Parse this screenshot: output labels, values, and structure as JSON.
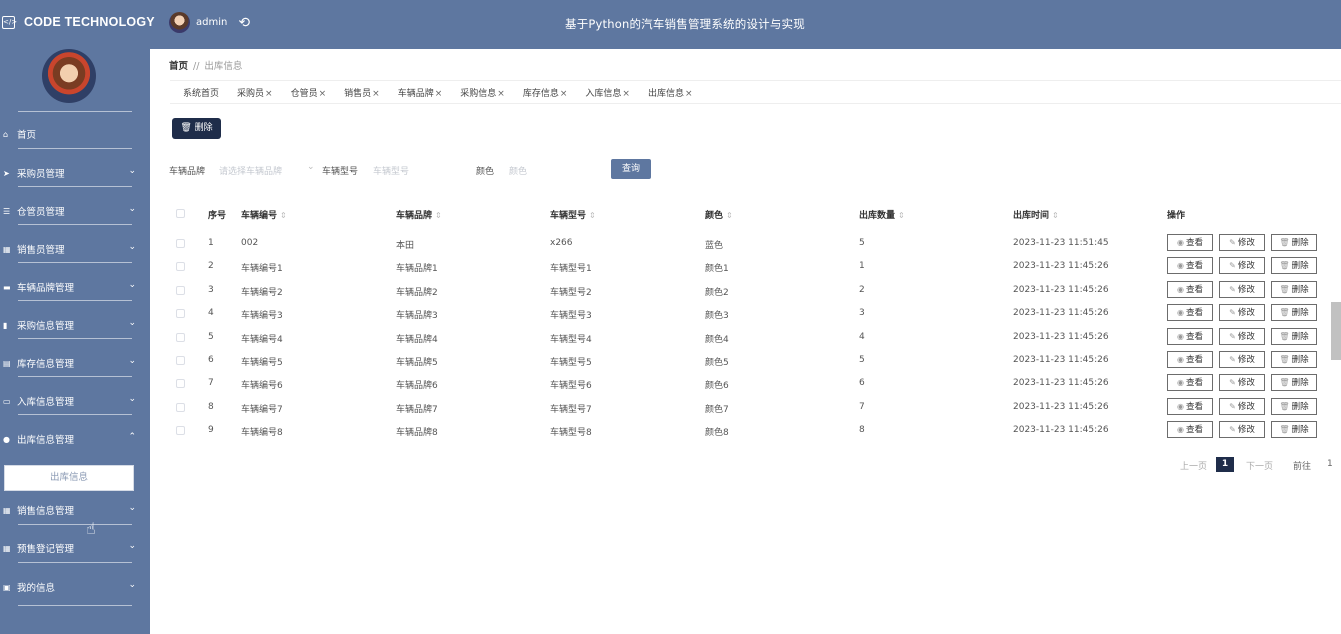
{
  "header": {
    "logo_text": "CODE TECHNOLOGY",
    "logo_icon": "code-icon",
    "user_name": "admin",
    "system_title": "基于Python的汽车销售管理系统的设计与实现"
  },
  "sidebar": {
    "items": [
      {
        "label": "首页",
        "icon": "home-icon"
      },
      {
        "label": "采购员管理",
        "icon": "send-icon"
      },
      {
        "label": "仓管员管理",
        "icon": "list-icon"
      },
      {
        "label": "销售员管理",
        "icon": "grid-icon"
      },
      {
        "label": "车辆品牌管理",
        "icon": "chat-icon"
      },
      {
        "label": "采购信息管理",
        "icon": "bar-chart-icon"
      },
      {
        "label": "库存信息管理",
        "icon": "ticket-icon"
      },
      {
        "label": "入库信息管理",
        "icon": "monitor-icon"
      },
      {
        "label": "出库信息管理",
        "icon": "user-icon"
      },
      {
        "label": "销售信息管理",
        "icon": "grid-icon"
      },
      {
        "label": "预售登记管理",
        "icon": "grid-icon"
      },
      {
        "label": "我的信息",
        "icon": "window-icon"
      }
    ],
    "sub_item": "出库信息"
  },
  "breadcrumb": {
    "home": "首页",
    "separator": "//",
    "current": "出库信息"
  },
  "tabs": [
    {
      "label": "系统首页",
      "closable": false
    },
    {
      "label": "采购员",
      "closable": true
    },
    {
      "label": "仓管员",
      "closable": true
    },
    {
      "label": "销售员",
      "closable": true
    },
    {
      "label": "车辆品牌",
      "closable": true
    },
    {
      "label": "采购信息",
      "closable": true
    },
    {
      "label": "库存信息",
      "closable": true
    },
    {
      "label": "入库信息",
      "closable": true
    },
    {
      "label": "出库信息",
      "closable": true
    }
  ],
  "toolbar": {
    "delete_label": "删除"
  },
  "filters": {
    "brand_label": "车辆品牌",
    "brand_placeholder": "请选择车辆品牌",
    "model_label": "车辆型号",
    "model_placeholder": "车辆型号",
    "color_label": "颜色",
    "color_placeholder": "颜色",
    "search_label": "查询"
  },
  "table": {
    "headers": [
      "序号",
      "车辆编号",
      "车辆品牌",
      "车辆型号",
      "颜色",
      "出库数量",
      "出库时间",
      "操作"
    ],
    "rows": [
      [
        "1",
        "002",
        "本田",
        "x266",
        "蓝色",
        "5",
        "2023-11-23 11:51:45"
      ],
      [
        "2",
        "车辆编号1",
        "车辆品牌1",
        "车辆型号1",
        "颜色1",
        "1",
        "2023-11-23 11:45:26"
      ],
      [
        "3",
        "车辆编号2",
        "车辆品牌2",
        "车辆型号2",
        "颜色2",
        "2",
        "2023-11-23 11:45:26"
      ],
      [
        "4",
        "车辆编号3",
        "车辆品牌3",
        "车辆型号3",
        "颜色3",
        "3",
        "2023-11-23 11:45:26"
      ],
      [
        "5",
        "车辆编号4",
        "车辆品牌4",
        "车辆型号4",
        "颜色4",
        "4",
        "2023-11-23 11:45:26"
      ],
      [
        "6",
        "车辆编号5",
        "车辆品牌5",
        "车辆型号5",
        "颜色5",
        "5",
        "2023-11-23 11:45:26"
      ],
      [
        "7",
        "车辆编号6",
        "车辆品牌6",
        "车辆型号6",
        "颜色6",
        "6",
        "2023-11-23 11:45:26"
      ],
      [
        "8",
        "车辆编号7",
        "车辆品牌7",
        "车辆型号7",
        "颜色7",
        "7",
        "2023-11-23 11:45:26"
      ],
      [
        "9",
        "车辆编号8",
        "车辆品牌8",
        "车辆型号8",
        "颜色8",
        "8",
        "2023-11-23 11:45:26"
      ]
    ],
    "actions": {
      "view": "查看",
      "edit": "修改",
      "delete": "删除"
    }
  },
  "pagination": {
    "prev": "上一页",
    "current": "1",
    "next": "下一页",
    "goto": "前往",
    "goto_value": "1"
  },
  "colors": {
    "brand": "#5e77a0",
    "dark": "#1f2d4a"
  }
}
